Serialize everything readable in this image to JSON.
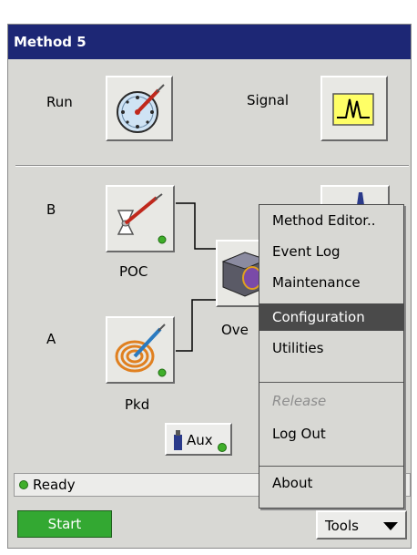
{
  "window": {
    "title": "Method 5"
  },
  "top": {
    "run_label": "Run",
    "signal_label": "Signal"
  },
  "flow": {
    "b_label": "B",
    "a_label": "A",
    "poc_label": "POC",
    "pkd_label": "Pkd",
    "oven_label": "Ove",
    "aux_label": "Aux"
  },
  "status": {
    "text": "Ready"
  },
  "bottom": {
    "start_label": "Start",
    "tools_label": "Tools"
  },
  "menu": {
    "items": [
      {
        "label": "Method Editor.."
      },
      {
        "label": "Event Log"
      },
      {
        "label": "Maintenance"
      },
      {
        "label": "Configuration"
      },
      {
        "label": "Utilities"
      },
      {
        "label": "Release"
      },
      {
        "label": "Log Out"
      },
      {
        "label": "About"
      }
    ]
  },
  "colors": {
    "titlebar": "#1d2775",
    "start": "#33a832",
    "status_led": "#3fae2a",
    "menu_selected": "#4a4a4a"
  }
}
